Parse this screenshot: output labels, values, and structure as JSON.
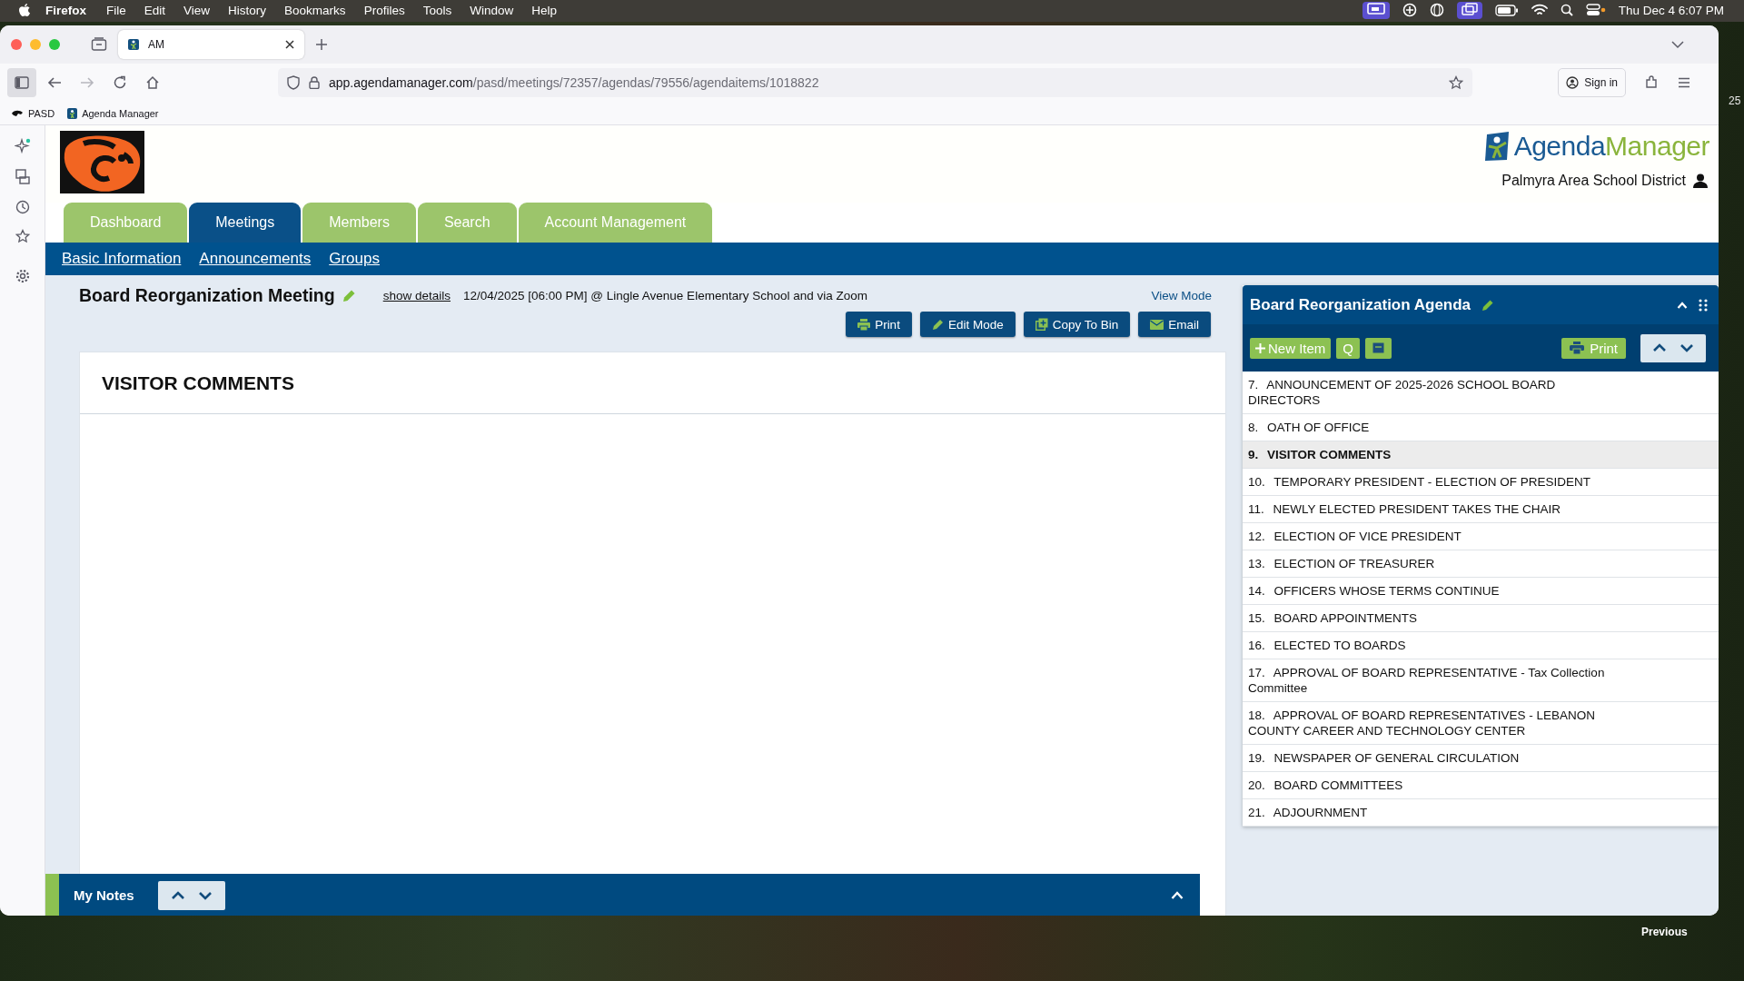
{
  "menu_bar": {
    "app": "Firefox",
    "menus": [
      "File",
      "Edit",
      "View",
      "History",
      "Bookmarks",
      "Profiles",
      "Tools",
      "Window",
      "Help"
    ],
    "clock": "Thu Dec 4  6:07 PM"
  },
  "browser": {
    "tabs": [
      {
        "title": "AM",
        "selected": true
      }
    ],
    "url": {
      "domain": "app.agendamanager.com",
      "path": "/pasd/meetings/72357/agendas/79556/agendaitems/1018822"
    },
    "sign_in": "Sign in",
    "bookmarks": [
      "PASD",
      "Agenda Manager"
    ]
  },
  "header": {
    "logo_text": {
      "first": "Agenda",
      "second": "Manager"
    },
    "organization": "Palmyra Area School District"
  },
  "nav_tabs": [
    {
      "label": "Dashboard",
      "selected": false
    },
    {
      "label": "Meetings",
      "selected": true
    },
    {
      "label": "Members",
      "selected": false
    },
    {
      "label": "Search",
      "selected": false
    },
    {
      "label": "Account Management",
      "selected": false
    }
  ],
  "sub_nav": [
    "Basic Information",
    "Announcements",
    "Groups"
  ],
  "meeting": {
    "title": "Board Reorganization Meeting",
    "show_details": "show details",
    "details": "12/04/2025 [06:00 PM] @ Lingle Avenue Elementary School and via Zoom",
    "view_mode": "View Mode",
    "actions": [
      {
        "kind": "print",
        "label": "Print"
      },
      {
        "kind": "edit",
        "label": "Edit Mode"
      },
      {
        "kind": "copy",
        "label": "Copy To Bin"
      },
      {
        "kind": "email",
        "label": "Email"
      }
    ]
  },
  "item": {
    "heading": "VISITOR COMMENTS"
  },
  "agenda": {
    "title": "Board Reorganization Agenda",
    "new_item": "New Item",
    "quick": "Q",
    "print": "Print",
    "items": [
      {
        "number": "7.",
        "title": "ANNOUNCEMENT OF 2025-2026 SCHOOL BOARD DIRECTORS",
        "selected": false
      },
      {
        "number": "8.",
        "title": "OATH OF OFFICE",
        "selected": false
      },
      {
        "number": "9.",
        "title": "VISITOR COMMENTS",
        "selected": true
      },
      {
        "number": "10.",
        "title": "TEMPORARY PRESIDENT - ELECTION OF PRESIDENT",
        "selected": false
      },
      {
        "number": "11.",
        "title": "NEWLY ELECTED PRESIDENT TAKES THE CHAIR",
        "selected": false
      },
      {
        "number": "12.",
        "title": "ELECTION OF VICE PRESIDENT",
        "selected": false
      },
      {
        "number": "13.",
        "title": "ELECTION OF TREASURER",
        "selected": false
      },
      {
        "number": "14.",
        "title": "OFFICERS WHOSE TERMS CONTINUE",
        "selected": false
      },
      {
        "number": "15.",
        "title": "BOARD APPOINTMENTS",
        "selected": false
      },
      {
        "number": "16.",
        "title": "ELECTED TO BOARDS",
        "selected": false
      },
      {
        "number": "17.",
        "title": "APPROVAL OF BOARD REPRESENTATIVE - Tax Collection Committee",
        "selected": false
      },
      {
        "number": "18.",
        "title": "APPROVAL OF BOARD REPRESENTATIVES - LEBANON COUNTY CAREER AND TECHNOLOGY CENTER",
        "selected": false
      },
      {
        "number": "19.",
        "title": "NEWSPAPER OF GENERAL CIRCULATION",
        "selected": false
      },
      {
        "number": "20.",
        "title": "BOARD COMMITTEES",
        "selected": false
      },
      {
        "number": "21.",
        "title": "ADJOURNMENT",
        "selected": false
      }
    ]
  },
  "notes_bar": {
    "title": "My Notes"
  },
  "desktop": {
    "edge_text": "25",
    "previous": "Previous"
  }
}
